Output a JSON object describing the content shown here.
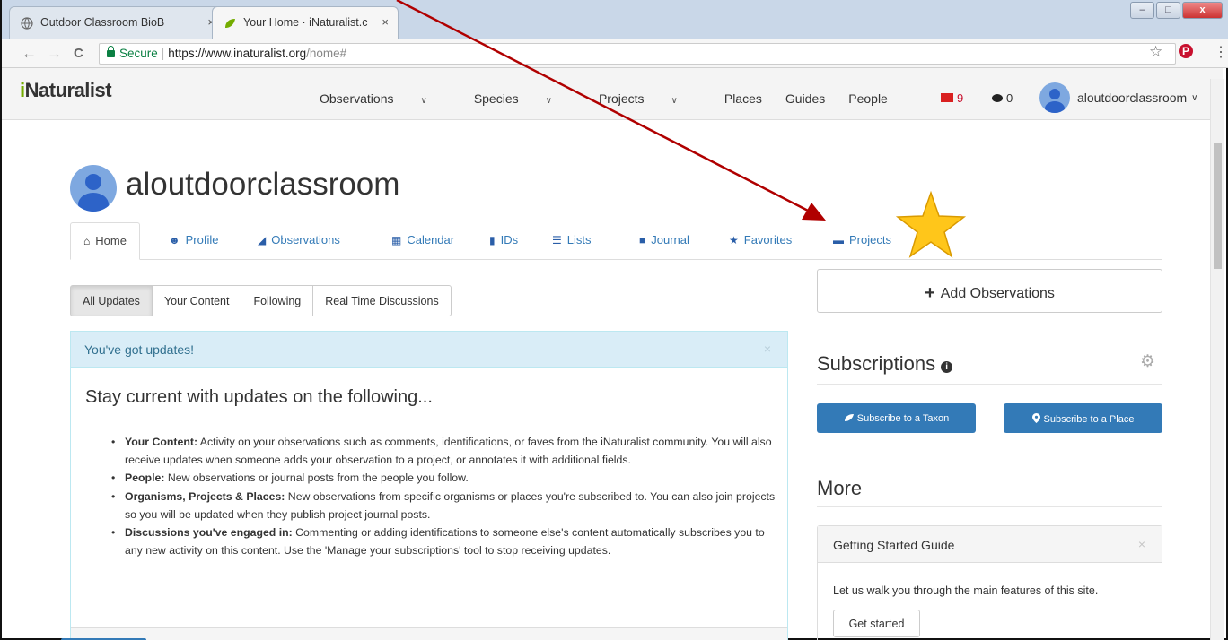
{
  "browser": {
    "tabs": [
      {
        "label": "Outdoor Classroom BioB",
        "icon": "globe-icon"
      },
      {
        "label": "Your Home · iNaturalist.c",
        "icon": "leaf-icon"
      }
    ],
    "tab_close": "×",
    "window_controls": [
      "–",
      "□",
      "x"
    ],
    "back": "←",
    "forward": "→",
    "reload": "C",
    "secure_label": "Secure",
    "url_host": "https://www.inaturalist.org",
    "url_path": "/home#",
    "bookmark_star": "☆",
    "pinterest": "P",
    "menu": "⋮"
  },
  "site": {
    "logo_i": "i",
    "logo_rest": "Naturalist",
    "nav": [
      "Observations",
      "Species",
      "Projects",
      "Places",
      "Guides",
      "People"
    ],
    "nav_chevrons": [
      "∨",
      "∨",
      "∨",
      "",
      "",
      ""
    ],
    "mail_count": "9",
    "chat_count": "0",
    "username": "aloutdoorclassroom",
    "user_chevron": "∨"
  },
  "profile": {
    "username": "aloutdoorclassroom",
    "tabs": [
      {
        "label": "Home",
        "icon": "⌂"
      },
      {
        "label": "Profile",
        "icon": "☻"
      },
      {
        "label": "Observations",
        "icon": "◢"
      },
      {
        "label": "Calendar",
        "icon": "▦"
      },
      {
        "label": "IDs",
        "icon": "▮"
      },
      {
        "label": "Lists",
        "icon": "☰"
      },
      {
        "label": "Journal",
        "icon": "■"
      },
      {
        "label": "Favorites",
        "icon": "★"
      },
      {
        "label": "Projects",
        "icon": "▬"
      }
    ]
  },
  "updates": {
    "filters": [
      "All Updates",
      "Your Content",
      "Following",
      "Real Time Discussions"
    ],
    "alert_title": "You've got updates!",
    "close": "×",
    "heading": "Stay current with updates on the following...",
    "items": [
      {
        "bold": "Your Content:",
        "text": " Activity on your observations such as comments, identifications, or faves from the iNaturalist community. You will also receive updates when someone adds your observation to a project, or annotates it with additional fields."
      },
      {
        "bold": "People:",
        "text": " New observations or journal posts from the people you follow."
      },
      {
        "bold": "Organisms, Projects & Places:",
        "text": " New observations from specific organisms or places you're subscribed to. You can also join projects so you will be updated when they publish project journal posts."
      },
      {
        "bold": "Discussions you've engaged in:",
        "text": " Commenting or adding identifications to someone else's content automatically subscribes you to any new activity on this content. Use the 'Manage your subscriptions' tool to stop receiving updates."
      }
    ]
  },
  "sidebar": {
    "add_observations": "Add Observations",
    "add_icon": "+",
    "subscriptions_title": "Subscriptions",
    "info_icon": "i",
    "gear_icon": "⚙",
    "subscribe_taxon": "Subscribe to a Taxon",
    "subscribe_place": "Subscribe to a Place",
    "more_title": "More",
    "guide_title": "Getting Started Guide",
    "guide_close": "×",
    "guide_text": "Let us walk you through the main features of this site.",
    "guide_button": "Get started"
  },
  "colors": {
    "brand_green": "#74ac00",
    "link_blue": "#337ab7",
    "alert_bg": "#d9edf7",
    "annotation_arrow": "#b00000",
    "annotation_star": "#ffc61a"
  }
}
